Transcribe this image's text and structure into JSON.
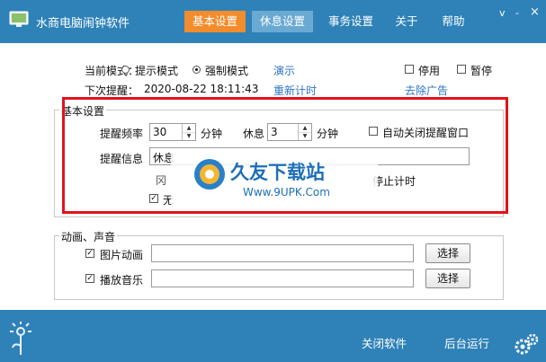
{
  "app": {
    "title": "水商电脑闹钟软件"
  },
  "tabs": [
    {
      "label": "基本设置"
    },
    {
      "label": "休息设置"
    },
    {
      "label": "事务设置"
    },
    {
      "label": "关于"
    },
    {
      "label": "帮助"
    }
  ],
  "window_controls": {
    "menu": "v",
    "minimize": "-",
    "close": "×"
  },
  "mode": {
    "label": "当前模式：",
    "options": [
      "提示模式",
      "强制模式"
    ],
    "selected": "强制模式",
    "demo_link": "演示"
  },
  "next_reminder": {
    "label": "下次提醒：",
    "value": "2020-08-22 18:11:43",
    "reset_link": "重新计时"
  },
  "top_checks": [
    {
      "label": "停用",
      "checked": false
    },
    {
      "label": "暂停",
      "checked": false
    }
  ],
  "remove_ads_link": "去除广告",
  "basic_group": {
    "title": "基本设置",
    "freq_label": "提醒频率",
    "freq_value": "30",
    "freq_unit": "分钟",
    "rest_label": "休息",
    "rest_value": "3",
    "rest_unit": "分钟",
    "auto_close": {
      "label": "自动关闭提醒窗口",
      "checked": false
    },
    "info_label": "提醒信息",
    "info_value": "休息",
    "pause_text": "停止计时",
    "partial_prefix": "冈",
    "partial_check_label": "无",
    "partial_check_checked": true
  },
  "media_group": {
    "title": "动画、声音",
    "rows": [
      {
        "label": "图片动画",
        "checked": true,
        "path": "",
        "button": "选择"
      },
      {
        "label": "播放音乐",
        "checked": true,
        "path": "",
        "button": "选择"
      }
    ]
  },
  "watermark": {
    "brand": "久友下载站",
    "url": "Www.9UPK.Com"
  },
  "footer": {
    "close_label": "关闭软件",
    "background_label": "后台运行"
  },
  "colors": {
    "titlebar": "#2f82b8",
    "active_tab": "#f28c2c",
    "link": "#2b73c7",
    "highlight_box": "#e0131c"
  }
}
